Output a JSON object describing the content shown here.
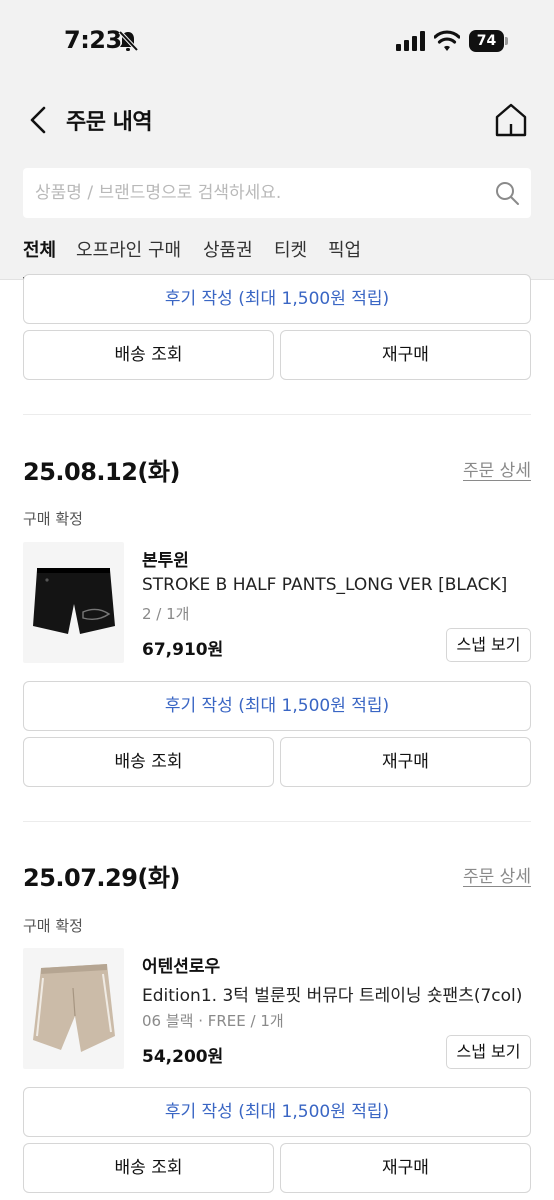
{
  "status_bar": {
    "time": "7:23",
    "battery": "74"
  },
  "nav": {
    "title": "주문 내역"
  },
  "search": {
    "placeholder": "상품명 / 브랜드명으로 검색하세요."
  },
  "tabs": [
    {
      "label": "전체",
      "active": true
    },
    {
      "label": "오프라인 구매",
      "active": false
    },
    {
      "label": "상품권",
      "active": false
    },
    {
      "label": "티켓",
      "active": false
    },
    {
      "label": "픽업",
      "active": false
    }
  ],
  "top_partial": {
    "review_label": "후기 작성 (최대 1,500원 적립)",
    "shipping_label": "배송 조회",
    "rebuy_label": "재구매"
  },
  "orders": [
    {
      "date": "25.08.12(화)",
      "detail_link": "주문 상세",
      "status": "구매 확정",
      "item": {
        "brand": "본투윈",
        "name": "STROKE B HALF PANTS_LONG VER [BLACK]",
        "option": "2 / 1개",
        "price": "67,910원",
        "snap_label": "스냅 보기"
      },
      "review_label": "후기 작성 (최대 1,500원 적립)",
      "shipping_label": "배송 조회",
      "rebuy_label": "재구매"
    },
    {
      "date": "25.07.29(화)",
      "detail_link": "주문 상세",
      "status": "구매 확정",
      "item": {
        "brand": "어텐션로우",
        "name": "Edition1. 3턱 벌룬핏 버뮤다 트레이닝 숏팬츠(7col)",
        "option": "06 블랙 · FREE / 1개",
        "price": "54,200원",
        "snap_label": "스냅 보기"
      },
      "review_label": "후기 작성 (최대 1,500원 적립)",
      "shipping_label": "배송 조회",
      "rebuy_label": "재구매"
    }
  ],
  "colors": {
    "accent_link": "#3a66c4",
    "header_bg": "#f2f2f2"
  }
}
